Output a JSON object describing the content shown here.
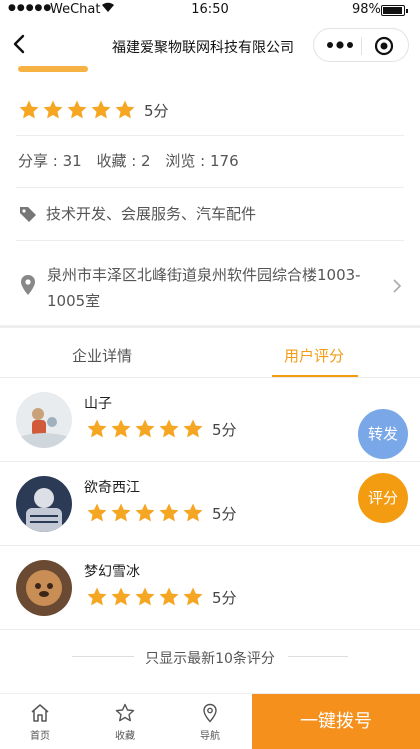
{
  "status_bar": {
    "signal": "●●●●●",
    "carrier": "WeChat",
    "wifi_icon": "wifi-icon",
    "time": "16:50",
    "battery": "98%"
  },
  "nav": {
    "title": "福建爱聚物联网科技有限公司"
  },
  "company": {
    "rating_stars": 5,
    "rating_label": "5分",
    "stats": [
      "分享 : 31",
      "收藏 : 2",
      "浏览 : 176"
    ],
    "tags": "技术开发、会展服务、汽车配件",
    "address": "泉州市丰泽区北峰街道泉州软件园综合楼1003-1005室"
  },
  "tabs": [
    {
      "label": "企业详情"
    },
    {
      "label": "用户评分"
    }
  ],
  "reviews": [
    {
      "name": "山子",
      "stars": 5,
      "score": "5分"
    },
    {
      "name": "欲奇西江",
      "stars": 5,
      "score": "5分"
    },
    {
      "name": "梦幻雪冰",
      "stars": 5,
      "score": "5分"
    }
  ],
  "floating": {
    "share": "转发",
    "rate": "评分"
  },
  "footnote": "只显示最新10条评分",
  "bottom_bar": {
    "items": [
      {
        "label": "首页",
        "icon": "home-icon"
      },
      {
        "label": "收藏",
        "icon": "star-outline-icon"
      },
      {
        "label": "导航",
        "icon": "location-icon"
      }
    ],
    "call_label": "一键拨号"
  },
  "colors": {
    "accent": "#f39c12",
    "star": "#f5a623",
    "share_button": "#7aa7e8",
    "call_button": "#f5901d"
  }
}
